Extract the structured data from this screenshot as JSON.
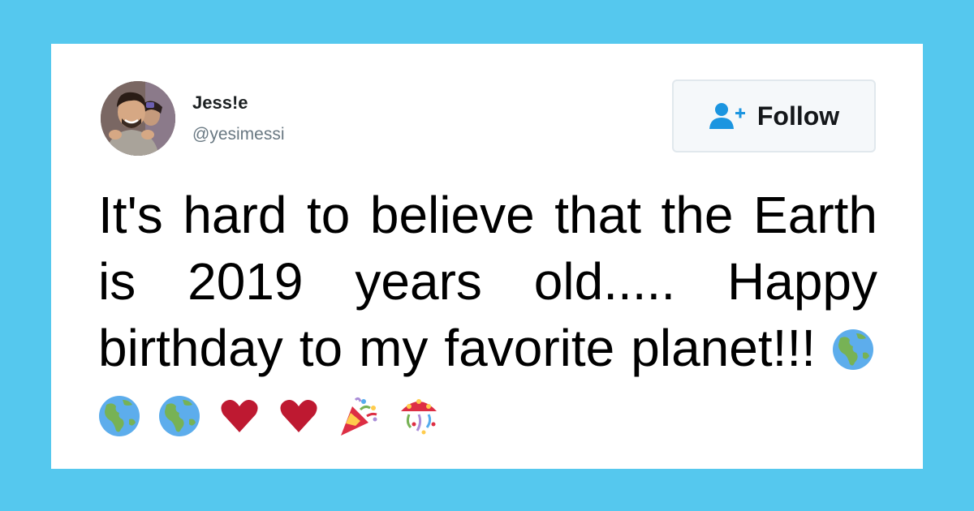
{
  "tweet": {
    "user": {
      "display_name": "Jess!e",
      "handle": "@yesimessi",
      "avatar_icon": "profile-photo"
    },
    "follow_button": {
      "label": "Follow",
      "icon": "add-user-icon",
      "icon_color": "#1b95e0"
    },
    "text": "It's hard to believe that the Earth is 2019 years old..... Happy birthday to my favorite planet!!!",
    "emojis": [
      "globe-americas-icon",
      "globe-americas-icon",
      "globe-americas-icon",
      "red-heart-icon",
      "red-heart-icon",
      "party-popper-icon",
      "confetti-ball-icon"
    ]
  },
  "colors": {
    "page_background": "#55c8ee",
    "card_background": "#ffffff",
    "name_color": "#1c2022",
    "handle_color": "#697882",
    "heart_color": "#be1931",
    "globe_ocean": "#5dadec",
    "globe_land": "#77b255"
  }
}
